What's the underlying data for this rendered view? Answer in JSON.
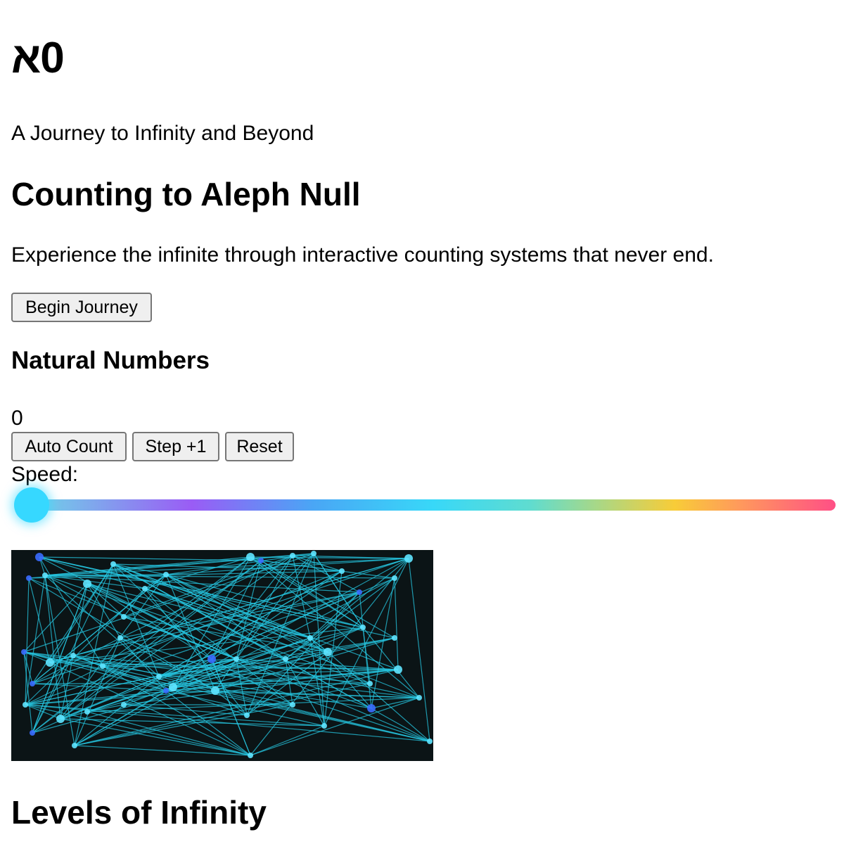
{
  "logo": {
    "symbol": "א",
    "subscript": "0"
  },
  "tagline": "A Journey to Infinity and Beyond",
  "section": {
    "title": "Counting to Aleph Null",
    "intro": "Experience the infinite through interactive counting systems that never end.",
    "begin_label": "Begin Journey"
  },
  "natural": {
    "title": "Natural Numbers",
    "counter": "0",
    "auto_label": "Auto Count",
    "step_label": "Step +1",
    "reset_label": "Reset",
    "speed_label": "Speed:"
  },
  "slider": {
    "value_fraction": 0
  },
  "colors": {
    "accent": "#36d8ff",
    "network_line": "#26c6e0",
    "network_bg": "#0b1416"
  },
  "levels": {
    "title": "Levels of Infinity"
  }
}
